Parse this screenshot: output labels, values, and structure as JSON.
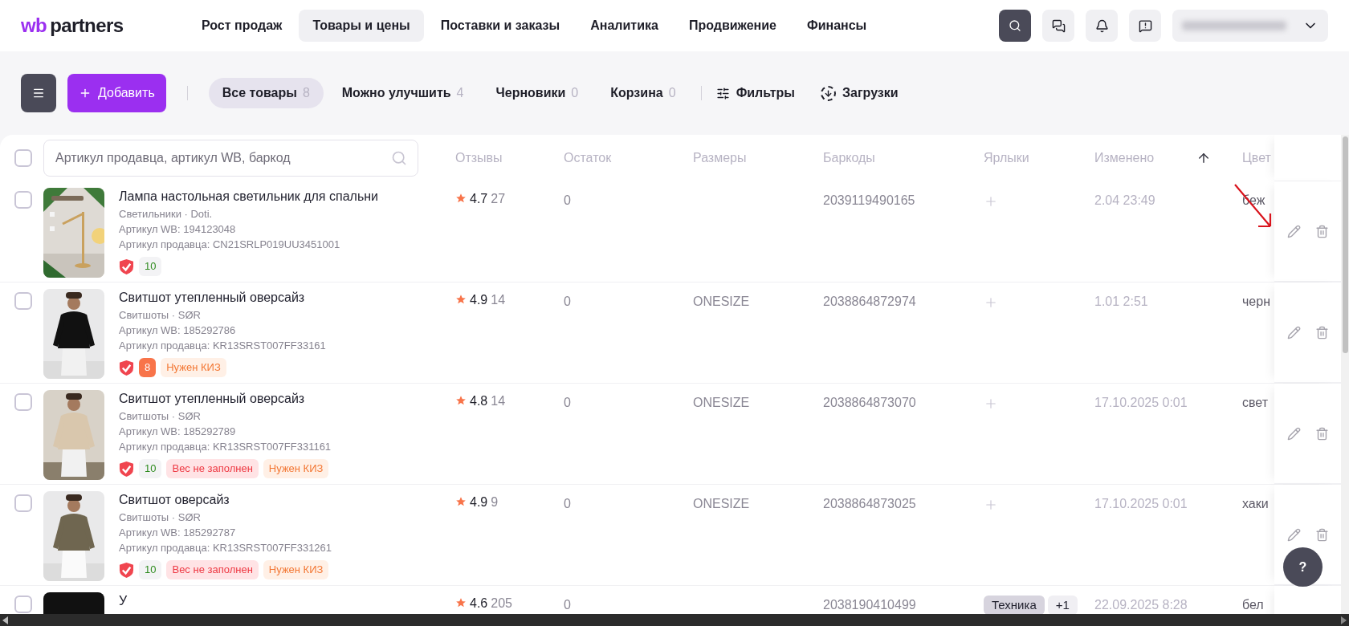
{
  "header": {
    "logo": {
      "brand": "wb",
      "name": "partners"
    },
    "nav": [
      {
        "label": "Рост продаж",
        "selected": false
      },
      {
        "label": "Товары и цены",
        "selected": true
      },
      {
        "label": "Поставки и заказы",
        "selected": false
      },
      {
        "label": "Аналитика",
        "selected": false
      },
      {
        "label": "Продвижение",
        "selected": false
      },
      {
        "label": "Финансы",
        "selected": false
      }
    ]
  },
  "toolbar": {
    "add_button": "Добавить",
    "tabs": [
      {
        "label": "Все товары",
        "count": "8",
        "selected": true
      },
      {
        "label": "Можно улучшить",
        "count": "4",
        "selected": false
      },
      {
        "label": "Черновики",
        "count": "0",
        "selected": false
      },
      {
        "label": "Корзина",
        "count": "0",
        "selected": false
      }
    ],
    "filters": "Фильтры",
    "downloads": "Загрузки"
  },
  "table": {
    "search": {
      "placeholder": "Артикул продавца, артикул WB, баркод"
    },
    "select_all": false,
    "columns": [
      "Отзывы",
      "Остаток",
      "Размеры",
      "Баркоды",
      "Ярлыки",
      "Изменено",
      "Цвет"
    ],
    "rows": [
      {
        "checked": false,
        "title": "Лампа настольная светильник для спальни",
        "category": "Светильники · Doti.",
        "wb_article": "Артикул WB: 194123048",
        "seller_article": "Артикул продавца: CN21SRLP019UU3451001",
        "score": {
          "value": "10",
          "kind": "good"
        },
        "tags": [],
        "rating": "4.7",
        "reviews": "27",
        "stock": "0",
        "barcode": "2039119490165",
        "labels": [],
        "changed": "2.04 23:49",
        "color_name": "беж"
      },
      {
        "checked": false,
        "title": "Свитшот утепленный оверсайз",
        "category": "Свитшоты · SØR",
        "wb_article": "Артикул WB: 185292786",
        "seller_article": "Артикул продавца: KR13SRST007FF33161",
        "score": {
          "value": "8",
          "kind": "warn"
        },
        "tags": [
          {
            "text": "Нужен КИЗ",
            "kind": "warning"
          }
        ],
        "rating": "4.9",
        "reviews": "14",
        "stock": "0",
        "size": "ONESIZE",
        "barcode": "2038864872974",
        "labels": [],
        "changed": "1.01 2:51",
        "color_name": "черн"
      },
      {
        "checked": false,
        "title": "Свитшот утепленный оверсайз",
        "category": "Свитшоты · SØR",
        "wb_article": "Артикул WB: 185292789",
        "seller_article": "Артикул продавца: KR13SRST007FF331161",
        "score": {
          "value": "10",
          "kind": "good"
        },
        "tags": [
          {
            "text": "Вес не заполнен",
            "kind": "error"
          },
          {
            "text": "Нужен КИЗ",
            "kind": "warning"
          }
        ],
        "rating": "4.8",
        "reviews": "14",
        "stock": "0",
        "size": "ONESIZE",
        "barcode": "2038864873070",
        "labels": [],
        "changed": "17.10.2025 0:01",
        "color_name": "свет"
      },
      {
        "checked": false,
        "title": "Свитшот оверсайз",
        "category": "Свитшоты · SØR",
        "wb_article": "Артикул WB: 185292787",
        "seller_article": "Артикул продавца: KR13SRST007FF331261",
        "score": {
          "value": "10",
          "kind": "good"
        },
        "tags": [
          {
            "text": "Вес не заполнен",
            "kind": "error"
          },
          {
            "text": "Нужен КИЗ",
            "kind": "warning"
          }
        ],
        "rating": "4.9",
        "reviews": "9",
        "stock": "0",
        "size": "ONESIZE",
        "barcode": "2038864873025",
        "labels": [],
        "changed": "17.10.2025 0:01",
        "color_name": "хаки"
      },
      {
        "checked": false,
        "title": "У",
        "rating": "4.6",
        "reviews": "205",
        "stock": "0",
        "barcode": "2038190410499",
        "labels": [
          "Техника",
          "+1"
        ],
        "changed": "22.09.2025 8:28",
        "color_name": "бел"
      }
    ]
  },
  "help_button": "?"
}
